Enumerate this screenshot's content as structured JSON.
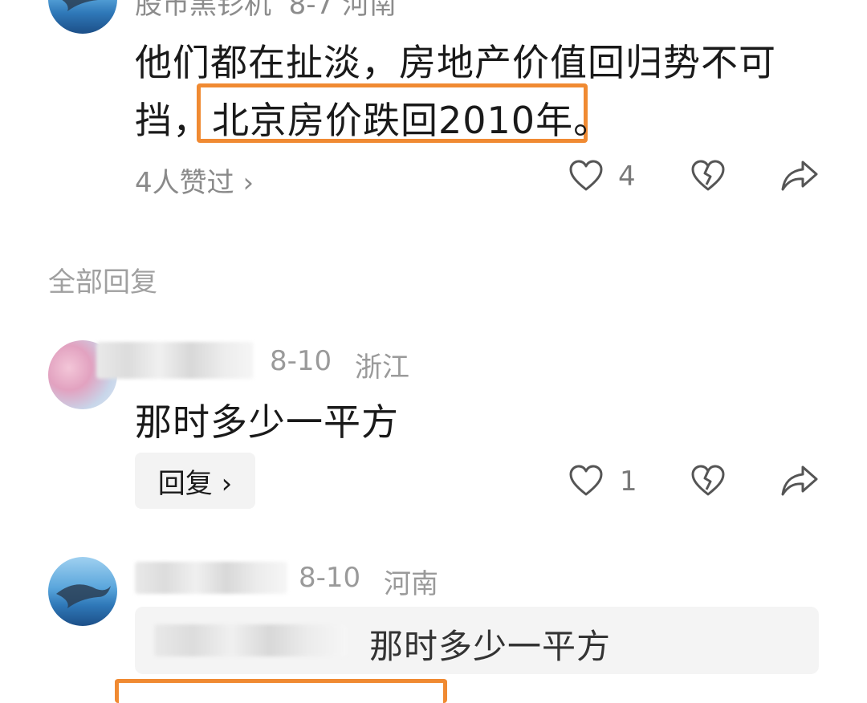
{
  "top_comment": {
    "author_partial": "股市黑钐机",
    "meta_partial": "8-7 河南",
    "text_line1": "他们都在扯淡，房地产价值回归势不可",
    "text_line2_prefix": "挡，",
    "text_line2_highlight": "北京房价跌回2010年。",
    "likes_link": "4人赞过 ›",
    "like_count": "4"
  },
  "section_title": "全部回复",
  "reply1": {
    "date": "8-10",
    "location": "浙江",
    "text": "那时多少一平方",
    "reply_button": "回复 ›",
    "like_count": "1"
  },
  "reply2": {
    "date": "8-10",
    "location": "河南",
    "quote_text": "那时多少一平方"
  },
  "colors": {
    "highlight": "#f08a32",
    "meta": "#9a9a9a"
  }
}
